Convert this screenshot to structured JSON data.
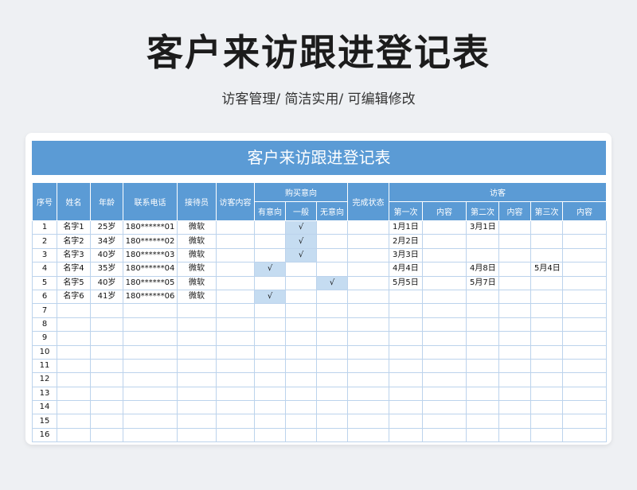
{
  "title": "客户来访跟进登记表",
  "subtitle": "访客管理/ 简洁实用/ 可编辑修改",
  "table_banner": "客户来访跟进登记表",
  "headers": {
    "seq": "序号",
    "name": "姓名",
    "age": "年龄",
    "phone": "联系电话",
    "receptionist": "接待员",
    "visit_content": "访客内容",
    "intent_group": "购买意向",
    "intent_yes": "有意向",
    "intent_normal": "一般",
    "intent_no": "无意向",
    "status": "完成状态",
    "visit_group": "访客",
    "first": "第一次",
    "content1": "内容",
    "second": "第二次",
    "content2": "内容",
    "third": "第三次",
    "content3": "内容"
  },
  "rows": [
    {
      "seq": "1",
      "name": "名字1",
      "age": "25岁",
      "phone": "180******01",
      "receptionist": "微软",
      "visit_content": "",
      "intent_yes": "",
      "intent_normal": "√",
      "intent_no": "",
      "status": "",
      "first": "1月1日",
      "content1": "",
      "second": "3月1日",
      "content2": "",
      "third": "",
      "content3": ""
    },
    {
      "seq": "2",
      "name": "名字2",
      "age": "34岁",
      "phone": "180******02",
      "receptionist": "微软",
      "visit_content": "",
      "intent_yes": "",
      "intent_normal": "√",
      "intent_no": "",
      "status": "",
      "first": "2月2日",
      "content1": "",
      "second": "",
      "content2": "",
      "third": "",
      "content3": ""
    },
    {
      "seq": "3",
      "name": "名字3",
      "age": "40岁",
      "phone": "180******03",
      "receptionist": "微软",
      "visit_content": "",
      "intent_yes": "",
      "intent_normal": "√",
      "intent_no": "",
      "status": "",
      "first": "3月3日",
      "content1": "",
      "second": "",
      "content2": "",
      "third": "",
      "content3": ""
    },
    {
      "seq": "4",
      "name": "名字4",
      "age": "35岁",
      "phone": "180******04",
      "receptionist": "微软",
      "visit_content": "",
      "intent_yes": "√",
      "intent_normal": "",
      "intent_no": "",
      "status": "",
      "first": "4月4日",
      "content1": "",
      "second": "4月8日",
      "content2": "",
      "third": "5月4日",
      "content3": ""
    },
    {
      "seq": "5",
      "name": "名字5",
      "age": "40岁",
      "phone": "180******05",
      "receptionist": "微软",
      "visit_content": "",
      "intent_yes": "",
      "intent_normal": "",
      "intent_no": "√",
      "status": "",
      "first": "5月5日",
      "content1": "",
      "second": "5月7日",
      "content2": "",
      "third": "",
      "content3": ""
    },
    {
      "seq": "6",
      "name": "名字6",
      "age": "41岁",
      "phone": "180******06",
      "receptionist": "微软",
      "visit_content": "",
      "intent_yes": "√",
      "intent_normal": "",
      "intent_no": "",
      "status": "",
      "first": "",
      "content1": "",
      "second": "",
      "content2": "",
      "third": "",
      "content3": ""
    },
    {
      "seq": "7"
    },
    {
      "seq": "8"
    },
    {
      "seq": "9"
    },
    {
      "seq": "10"
    },
    {
      "seq": "11"
    },
    {
      "seq": "12"
    },
    {
      "seq": "13"
    },
    {
      "seq": "14"
    },
    {
      "seq": "15"
    },
    {
      "seq": "16"
    }
  ],
  "colors": {
    "header_blue": "#5b9bd5",
    "highlight": "#c5dcf1",
    "grid": "#bcd3ec"
  }
}
